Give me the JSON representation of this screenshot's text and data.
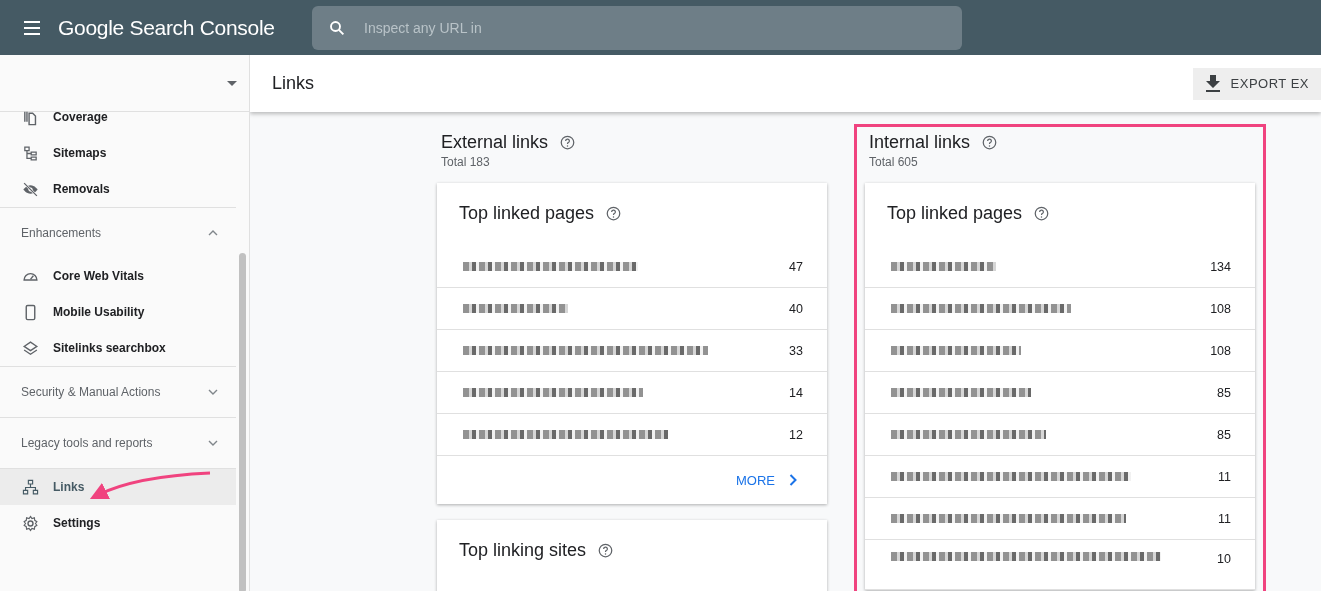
{
  "top_bar": {
    "title": "Google Search Console",
    "search": {
      "placeholder": "Inspect any URL in"
    }
  },
  "sidebar": {
    "items": [
      {
        "kind": "item",
        "label": "Coverage",
        "selected": false
      },
      {
        "kind": "item",
        "label": "Sitemaps",
        "selected": false
      },
      {
        "kind": "item",
        "label": "Removals",
        "selected": false
      },
      {
        "kind": "section",
        "label": "Enhancements",
        "expanded": true
      },
      {
        "kind": "item",
        "label": "Core Web Vitals",
        "selected": false
      },
      {
        "kind": "item",
        "label": "Mobile Usability",
        "selected": false
      },
      {
        "kind": "item",
        "label": "Sitelinks searchbox",
        "selected": false
      },
      {
        "kind": "section",
        "label": "Security & Manual Actions",
        "expanded": false
      },
      {
        "kind": "section",
        "label": "Legacy tools and reports",
        "expanded": false
      },
      {
        "kind": "item",
        "label": "Links",
        "selected": true
      },
      {
        "kind": "item",
        "label": "Settings",
        "selected": false
      }
    ]
  },
  "page": {
    "title": "Links",
    "export_button": "EXPORT EX"
  },
  "columns": [
    {
      "title": "External links",
      "total": "Total 183",
      "highlighted": false,
      "cards": [
        {
          "title": "Top linked pages",
          "more": "MORE",
          "rows": [
            {
              "count": "47"
            },
            {
              "count": "40"
            },
            {
              "count": "33"
            },
            {
              "count": "14"
            },
            {
              "count": "12"
            }
          ]
        },
        {
          "title": "Top linking sites"
        }
      ]
    },
    {
      "title": "Internal links",
      "total": "Total 605",
      "highlighted": true,
      "cards": [
        {
          "title": "Top linked pages",
          "rows": [
            {
              "count": "134"
            },
            {
              "count": "108"
            },
            {
              "count": "108"
            },
            {
              "count": "85"
            },
            {
              "count": "85"
            },
            {
              "count": "11"
            },
            {
              "count": "11"
            },
            {
              "count": "10"
            }
          ]
        }
      ]
    }
  ]
}
